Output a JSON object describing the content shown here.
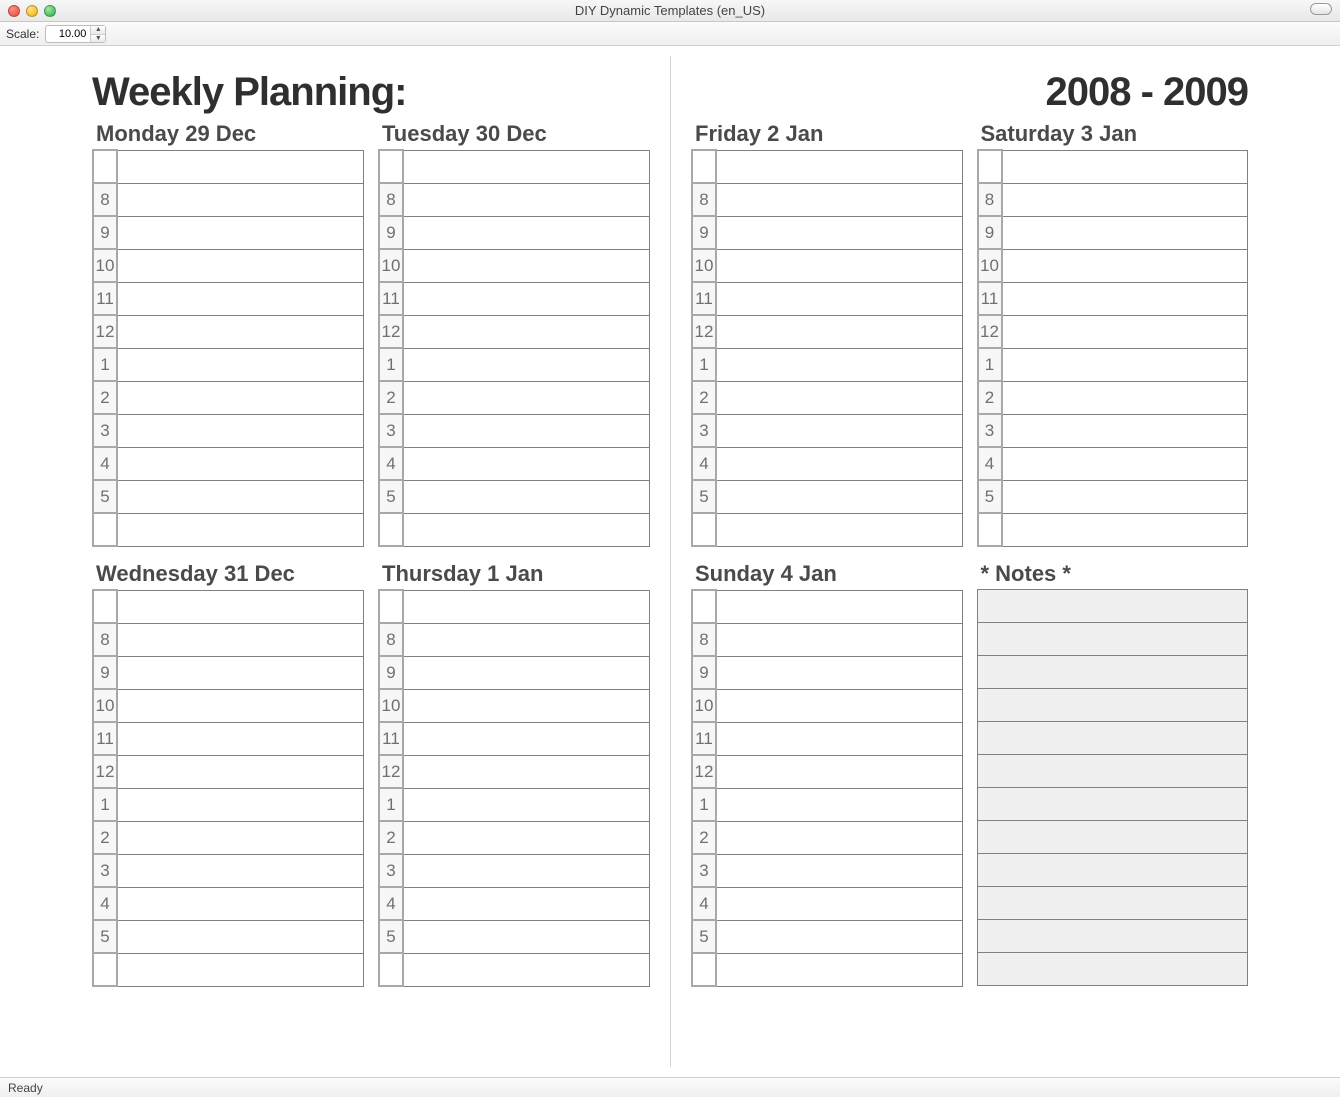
{
  "window": {
    "title": "DIY Dynamic Templates (en_US)"
  },
  "toolbar": {
    "scale_label": "Scale:",
    "scale_value": "10.00"
  },
  "status": {
    "text": "Ready"
  },
  "planner": {
    "heading_left": "Weekly Planning:",
    "heading_right": "2008 - 2009",
    "hours": [
      "",
      "8",
      "9",
      "10",
      "11",
      "12",
      "1",
      "2",
      "3",
      "4",
      "5",
      ""
    ],
    "days_left": [
      {
        "label": "Monday 29 Dec"
      },
      {
        "label": "Tuesday 30 Dec"
      },
      {
        "label": "Wednesday 31 Dec"
      },
      {
        "label": "Thursday 1 Jan"
      }
    ],
    "days_right": [
      {
        "label": "Friday 2 Jan"
      },
      {
        "label": "Saturday 3 Jan"
      },
      {
        "label": "Sunday 4 Jan"
      }
    ],
    "notes_label": "* Notes *",
    "notes_rows": 12
  }
}
